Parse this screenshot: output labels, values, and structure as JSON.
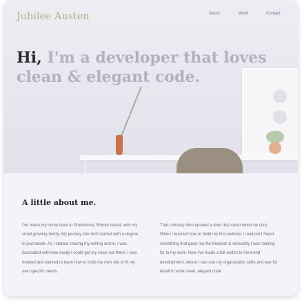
{
  "brand": {
    "name": "Jubilee Austen"
  },
  "nav": {
    "items": [
      "About",
      "Work",
      "Contact"
    ]
  },
  "hero": {
    "greeting": "Hi,",
    "headline": "I'm a developer that loves clean & elegant code."
  },
  "about": {
    "title": "A little about me.",
    "paragraph_1": "I've made my home base in Providence, Rhode Island, with my small growing family. My journey into tech started with a degree in journalism. As I started sharing my writing online, I was fascinated with how easily I could get my voice out there. I was hooked and wanted to learn how to build my own site to fit my own specific needs.",
    "paragraph_2": "That curiosity then opened a door that could never be shut. When I learned how to build my first website, I realized I found something that gave me the freedom & versatility I was looking for in my work. Now I've made a full switch to front-end development, where I can use my organization skills and eye for detail to write clean, elegant code."
  },
  "colors": {
    "brand": "#a3b47e",
    "headline_muted": "#b2b2bb",
    "headline_dark": "#2b2b30"
  }
}
